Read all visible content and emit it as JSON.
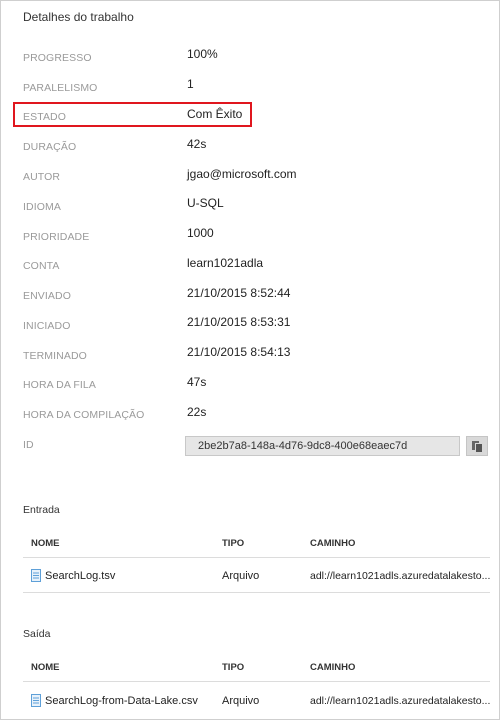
{
  "header": {
    "title": "Detalhes do trabalho"
  },
  "properties": [
    {
      "label": "PROGRESSO",
      "value": "100%"
    },
    {
      "label": "PARALELISMO",
      "value": "1"
    },
    {
      "label": "ESTADO",
      "value": "Com Êxito"
    },
    {
      "label": "DURAÇÃO",
      "value": "42s"
    },
    {
      "label": "AUTOR",
      "value": "jgao@microsoft.com"
    },
    {
      "label": "IDIOMA",
      "value": "U-SQL"
    },
    {
      "label": "PRIORIDADE",
      "value": "1000"
    },
    {
      "label": "CONTA",
      "value": "learn1021adla"
    },
    {
      "label": "ENVIADO",
      "value": "21/10/2015 8:52:44"
    },
    {
      "label": "INICIADO",
      "value": "21/10/2015 8:53:31"
    },
    {
      "label": "TERMINADO",
      "value": "21/10/2015 8:54:13"
    },
    {
      "label": "HORA DA FILA",
      "value": "47s"
    },
    {
      "label": "HORA DA COMPILAÇÃO",
      "value": "22s"
    }
  ],
  "id_field": {
    "label": "ID",
    "value": "2be2b7a8-148a-4d76-9dc8-400e68eaec7d"
  },
  "columns": {
    "name": "NOME",
    "type": "TIPO",
    "path": "CAMINHO"
  },
  "input": {
    "title": "Entrada",
    "rows": [
      {
        "name": "SearchLog.tsv",
        "type": "Arquivo",
        "path": "adl://learn1021adls.azuredatalakesto..."
      }
    ]
  },
  "output": {
    "title": "Saída",
    "rows": [
      {
        "name": "SearchLog-from-Data-Lake.csv",
        "type": "Arquivo",
        "path": "adl://learn1021adls.azuredatalakesto..."
      }
    ]
  },
  "colors": {
    "highlight": "#e0161e",
    "file_icon": "#5ea0d8"
  },
  "icons": {
    "copy": "copy-icon",
    "file": "file-icon"
  }
}
